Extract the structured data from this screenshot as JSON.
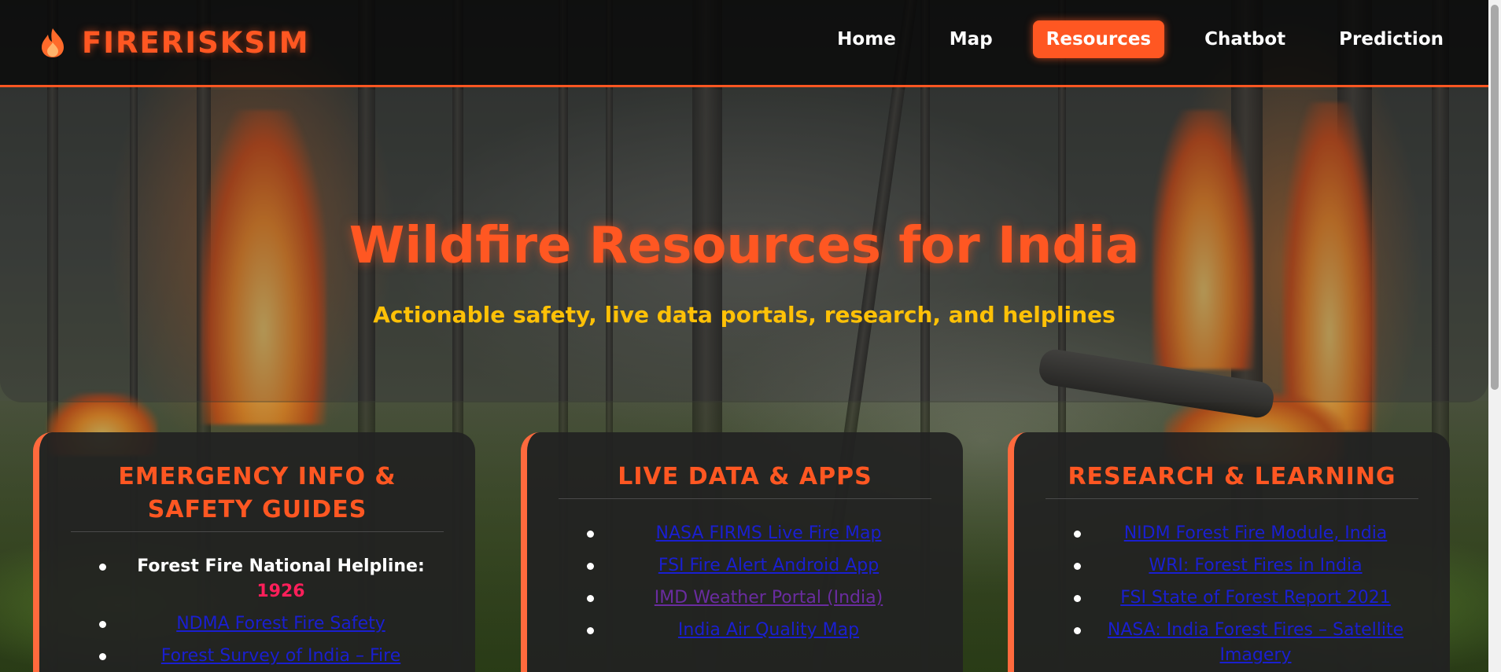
{
  "header": {
    "brand": "FIRERISKSIM",
    "nav": [
      {
        "label": "Home",
        "active": false
      },
      {
        "label": "Map",
        "active": false
      },
      {
        "label": "Resources",
        "active": true
      },
      {
        "label": "Chatbot",
        "active": false
      },
      {
        "label": "Prediction",
        "active": false
      }
    ]
  },
  "hero": {
    "title": "Wildfire Resources for India",
    "subtitle": "Actionable safety, live data portals, research, and helplines"
  },
  "cards": [
    {
      "title": "EMERGENCY INFO & SAFETY GUIDES",
      "helpline_label": "Forest Fire National Helpline:",
      "helpline_number": "1926",
      "links": [
        "NDMA Forest Fire Safety",
        "Forest Survey of India – Fire Management"
      ]
    },
    {
      "title": "LIVE DATA & APPS",
      "links": [
        "NASA FIRMS Live Fire Map",
        "FSI Fire Alert Android App",
        "IMD Weather Portal (India)",
        "India Air Quality Map"
      ]
    },
    {
      "title": "RESEARCH & LEARNING",
      "links": [
        "NIDM Forest Fire Module, India",
        "WRI: Forest Fires in India",
        "FSI State of Forest Report 2021",
        "NASA: India Forest Fires – Satellite Imagery"
      ]
    }
  ],
  "colors": {
    "accent": "#ff5722",
    "subtitle": "#ffc107",
    "helpline": "#ff1f5a",
    "link": "#1a1fd0",
    "visited_link": "#6a2ca0"
  },
  "icons": {
    "brand": "flame-icon"
  }
}
